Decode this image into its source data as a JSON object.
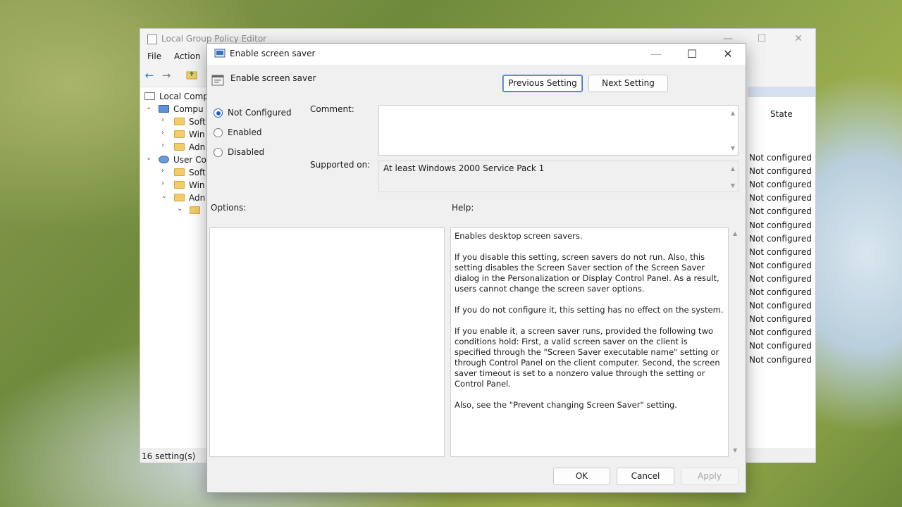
{
  "background_window": {
    "title": "Local Group Policy Editor",
    "menu": [
      "File",
      "Action"
    ],
    "tree": [
      {
        "label": "Local Comp",
        "indent": 0,
        "chev": "",
        "kind": "doc"
      },
      {
        "label": "Compu",
        "indent": 1,
        "chev": "⌄",
        "kind": "computer"
      },
      {
        "label": "Soft",
        "indent": 2,
        "chev": "›",
        "kind": "folder"
      },
      {
        "label": "Win",
        "indent": 2,
        "chev": "›",
        "kind": "folder"
      },
      {
        "label": "Adn",
        "indent": 2,
        "chev": "›",
        "kind": "folder"
      },
      {
        "label": "User Co",
        "indent": 1,
        "chev": "⌄",
        "kind": "user"
      },
      {
        "label": "Soft",
        "indent": 2,
        "chev": "›",
        "kind": "folder"
      },
      {
        "label": "Win",
        "indent": 2,
        "chev": "›",
        "kind": "folder"
      },
      {
        "label": "Adn",
        "indent": 2,
        "chev": "⌄",
        "kind": "folder"
      },
      {
        "label": "",
        "indent": 3,
        "chev": "⌄",
        "kind": "folder"
      }
    ],
    "state_header": "State",
    "states": [
      "Not configured",
      "Not configured",
      "Not configured",
      "Not configured",
      "Not configured",
      "Not configured",
      "Not configured",
      "Not configured",
      "Not configured",
      "Not configured",
      "Not configured",
      "Not configured",
      "Not configured",
      "Not configured",
      "Not configured",
      "Not configured"
    ],
    "status": "16 setting(s)"
  },
  "dialog": {
    "title": "Enable screen saver",
    "setting_name": "Enable screen saver",
    "prev_label": "Previous Setting",
    "next_label": "Next Setting",
    "options": [
      {
        "label": "Not Configured",
        "selected": true
      },
      {
        "label": "Enabled",
        "selected": false
      },
      {
        "label": "Disabled",
        "selected": false
      }
    ],
    "comment_label": "Comment:",
    "comment_value": "",
    "supported_label": "Supported on:",
    "supported_value": "At least Windows 2000 Service Pack 1",
    "options_label": "Options:",
    "help_label": "Help:",
    "help_paragraphs": [
      "Enables desktop screen savers.",
      "If you disable this setting, screen savers do not run. Also, this setting disables the Screen Saver section of the Screen Saver dialog in the Personalization or Display Control Panel. As a result, users cannot change the screen saver options.",
      "If you do not configure it, this setting has no effect on the system.",
      "If you enable it, a screen saver runs, provided the following two conditions hold: First, a valid screen saver on the client is specified through the \"Screen Saver executable name\" setting or through Control Panel on the client computer. Second, the screen saver timeout is set to a nonzero value through the setting or Control Panel.",
      "Also, see the \"Prevent changing Screen Saver\" setting."
    ],
    "ok_label": "OK",
    "cancel_label": "Cancel",
    "apply_label": "Apply"
  },
  "icons": {
    "minimize": "—",
    "maximize": "☐",
    "close": "✕",
    "back": "←",
    "forward": "→",
    "scroll_up": "▲",
    "scroll_down": "▼"
  },
  "colors": {
    "accent": "#1f5fbf",
    "folder": "#f2cc6b"
  }
}
